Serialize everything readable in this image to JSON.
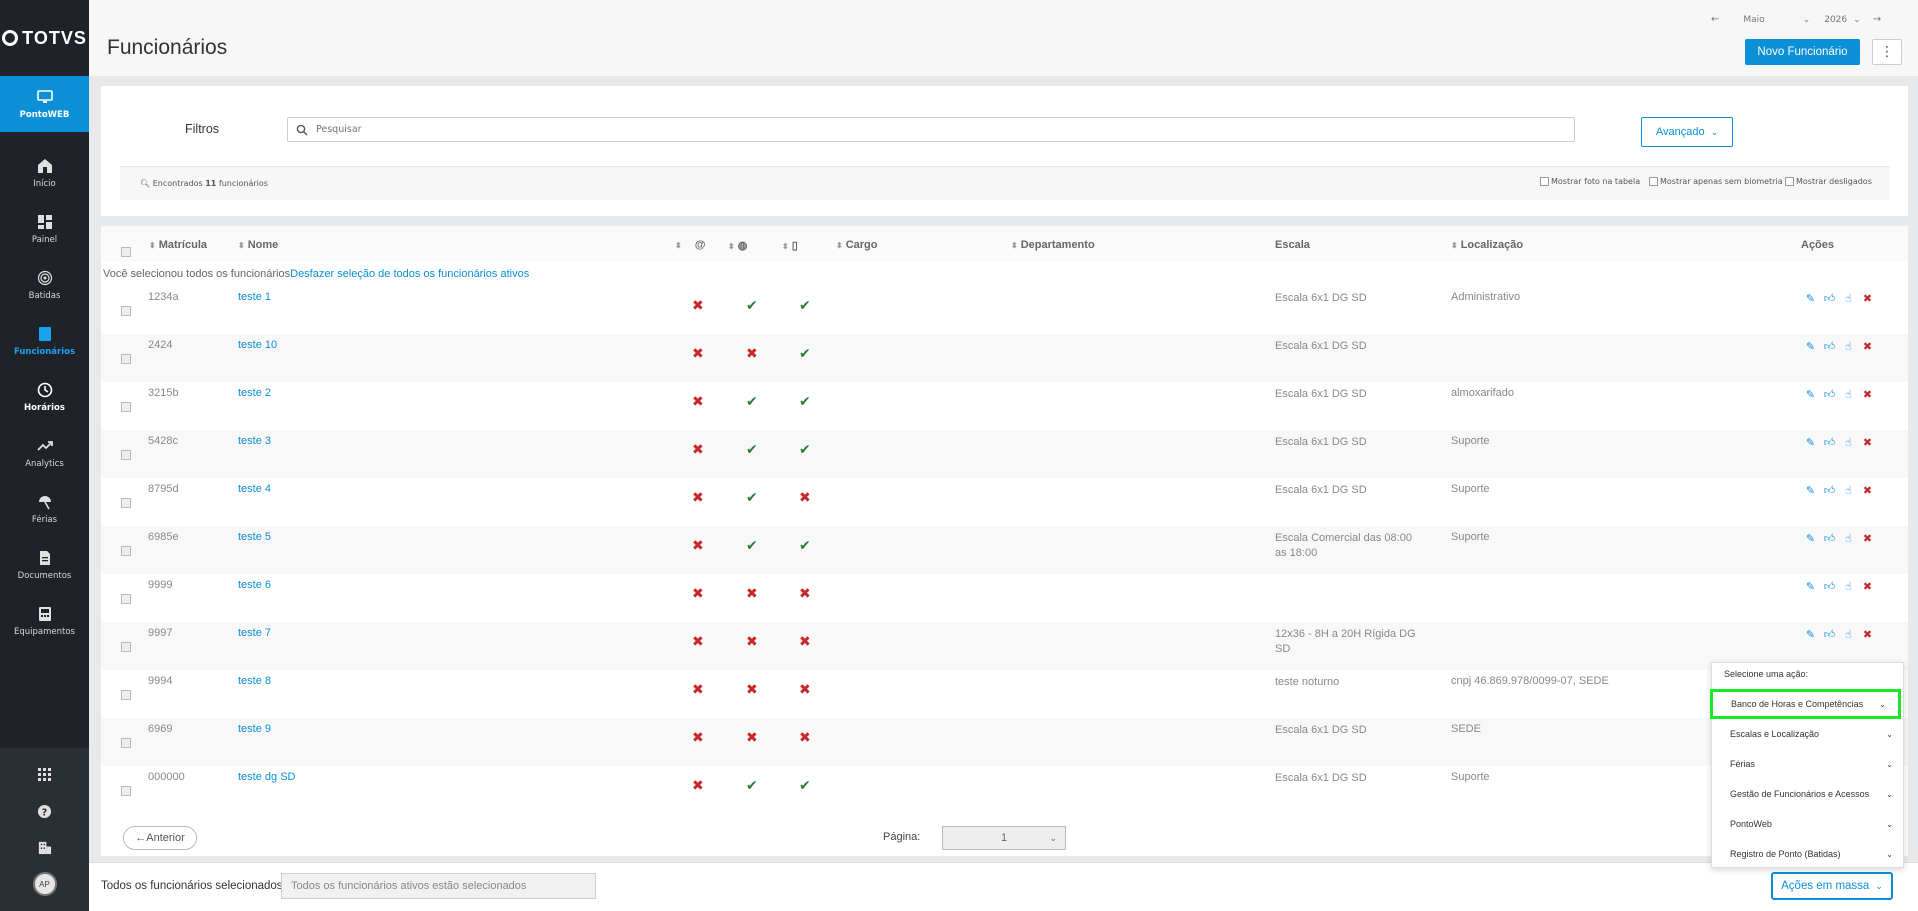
{
  "brand": "TOTVS",
  "sidebar": {
    "items": [
      {
        "label": "PontoWEB",
        "icon": "monitor-icon"
      },
      {
        "label": "Início",
        "icon": "home-icon"
      },
      {
        "label": "Painel",
        "icon": "dashboard-icon"
      },
      {
        "label": "Batidas",
        "icon": "fingerprint-icon"
      },
      {
        "label": "Funcionários",
        "icon": "badge-icon"
      },
      {
        "label": "Horários",
        "icon": "clock-icon"
      },
      {
        "label": "Analytics",
        "icon": "trend-icon"
      },
      {
        "label": "Férias",
        "icon": "beach-umbrella-icon"
      },
      {
        "label": "Documentos",
        "icon": "document-icon"
      },
      {
        "label": "Equipamentos",
        "icon": "device-icon"
      }
    ],
    "avatar": "AP"
  },
  "header": {
    "title": "Funcionários",
    "month": "Maio",
    "year": "2026",
    "new_button": "Novo Funcionário"
  },
  "filters": {
    "label": "Filtros",
    "search_placeholder": "Pesquisar",
    "advanced": "Avançado",
    "found_prefix": "Encontrados",
    "found_count": "11",
    "found_suffix": "funcionários",
    "opt_photo": "Mostrar foto na tabela",
    "opt_biometry": "Mostrar apenas sem biometria",
    "opt_disabled": "Mostrar desligados"
  },
  "table": {
    "columns": {
      "matricula": "Matrícula",
      "nome": "Nome",
      "cargo": "Cargo",
      "departamento": "Departamento",
      "escala": "Escala",
      "localizacao": "Localização",
      "acoes": "Ações"
    },
    "selection_info": "Você selecionou todos os funcionários",
    "selection_link": "Desfazer seleção de todos os funcionários ativos",
    "rows": [
      {
        "matricula": "1234a",
        "nome": "teste 1",
        "s1": "x",
        "s2": "v",
        "s3": "v",
        "escala": "Escala 6x1 DG SD",
        "local": "Administrativo"
      },
      {
        "matricula": "2424",
        "nome": "teste 10",
        "s1": "x",
        "s2": "x",
        "s3": "v",
        "escala": "Escala 6x1 DG SD",
        "local": ""
      },
      {
        "matricula": "3215b",
        "nome": "teste 2",
        "s1": "x",
        "s2": "v",
        "s3": "v",
        "escala": "Escala 6x1 DG SD",
        "local": "almoxarifado"
      },
      {
        "matricula": "5428c",
        "nome": "teste 3",
        "s1": "x",
        "s2": "v",
        "s3": "v",
        "escala": "Escala 6x1 DG SD",
        "local": "Suporte"
      },
      {
        "matricula": "8795d",
        "nome": "teste 4",
        "s1": "x",
        "s2": "v",
        "s3": "x",
        "escala": "Escala 6x1 DG SD",
        "local": "Suporte"
      },
      {
        "matricula": "6985e",
        "nome": "teste 5",
        "s1": "x",
        "s2": "v",
        "s3": "v",
        "escala": "Escala Comercial das 08:00 as 18:00",
        "local": "Suporte"
      },
      {
        "matricula": "9999",
        "nome": "teste 6",
        "s1": "x",
        "s2": "x",
        "s3": "x",
        "escala": "",
        "local": ""
      },
      {
        "matricula": "9997",
        "nome": "teste 7",
        "s1": "x",
        "s2": "x",
        "s3": "x",
        "escala": "12x36 - 8H a 20H Rígida DG SD",
        "local": ""
      },
      {
        "matricula": "9994",
        "nome": "teste 8",
        "s1": "x",
        "s2": "x",
        "s3": "x",
        "escala": "teste noturno",
        "local": "cnpj 46.869.978/0099-07, SEDE"
      },
      {
        "matricula": "6969",
        "nome": "teste 9",
        "s1": "x",
        "s2": "x",
        "s3": "x",
        "escala": "Escala 6x1 DG SD",
        "local": "SEDE"
      },
      {
        "matricula": "000000",
        "nome": "teste dg SD",
        "s1": "x",
        "s2": "v",
        "s3": "v",
        "escala": "Escala 6x1 DG SD",
        "local": "Suporte"
      }
    ]
  },
  "pagination": {
    "prev": "←Anterior",
    "page_label": "Página:",
    "page_value": "1"
  },
  "footer": {
    "label": "Todos os funcionários selecionados",
    "input_value": "Todos os funcionários ativos estão selecionados",
    "mass_button": "Ações em massa"
  },
  "dropdown": {
    "title": "Selecione uma ação:",
    "items": [
      "Banco de Horas e Competências",
      "Escalas e Localização",
      "Férias",
      "Gestão de Funcionários e Acessos",
      "PontoWeb",
      "Registro de Ponto (Batidas)"
    ],
    "selected_index": 0
  },
  "colors": {
    "accent": "#0b8fd6",
    "sidebar_bg": "#1f2329",
    "ok": "#2e7d32",
    "error": "#c62828",
    "highlight": "#16e82e"
  }
}
